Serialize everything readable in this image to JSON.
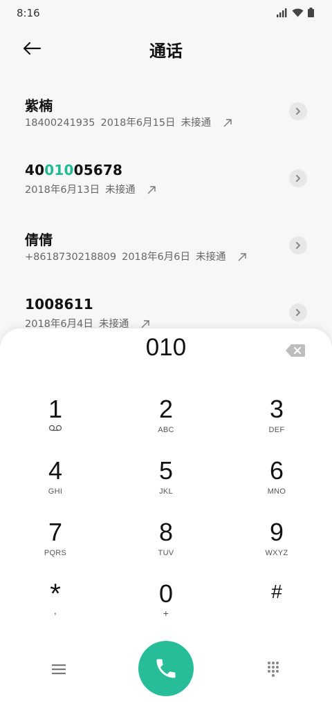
{
  "status": {
    "time": "8:16"
  },
  "header": {
    "title": "通话"
  },
  "calls": [
    {
      "name": "紫楠",
      "number": "18400241935",
      "date": "2018年6月15日",
      "status": "未接通"
    },
    {
      "name_pre": "40",
      "name_hl": "010",
      "name_post": "05678",
      "date": "2018年6月13日",
      "status": "未接通"
    },
    {
      "name": "倩倩",
      "number": "+8618730218809",
      "date": "2018年6月6日",
      "status": "未接通"
    },
    {
      "name": "1008611",
      "date": "2018年6月4日",
      "status": "未接通"
    }
  ],
  "dialpad": {
    "input": "010",
    "keys": [
      {
        "digit": "1",
        "letters": ""
      },
      {
        "digit": "2",
        "letters": "ABC"
      },
      {
        "digit": "3",
        "letters": "DEF"
      },
      {
        "digit": "4",
        "letters": "GHI"
      },
      {
        "digit": "5",
        "letters": "JKL"
      },
      {
        "digit": "6",
        "letters": "MNO"
      },
      {
        "digit": "7",
        "letters": "PQRS"
      },
      {
        "digit": "8",
        "letters": "TUV"
      },
      {
        "digit": "9",
        "letters": "WXYZ"
      },
      {
        "digit": "*",
        "letters": ","
      },
      {
        "digit": "0",
        "letters": "+"
      },
      {
        "digit": "#",
        "letters": ""
      }
    ]
  },
  "icons": {
    "back": "arrow-left-icon",
    "detail": "chevron-right-icon",
    "outgoing": "outgoing-arrow-icon",
    "backspace": "backspace-icon",
    "voicemail": "voicemail-icon",
    "menu": "menu-icon",
    "call": "phone-icon",
    "keypad": "keypad-icon"
  },
  "colors": {
    "accent": "#27bd98",
    "highlight": "#21b893"
  }
}
